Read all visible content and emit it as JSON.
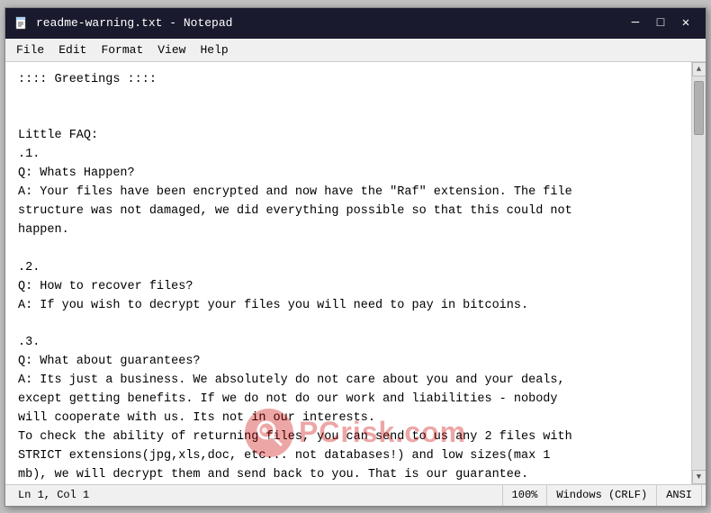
{
  "window": {
    "title": "readme-warning.txt - Notepad",
    "icon": "📄"
  },
  "titlebar": {
    "minimize_label": "─",
    "maximize_label": "□",
    "close_label": "✕"
  },
  "menubar": {
    "items": [
      "File",
      "Edit",
      "Format",
      "View",
      "Help"
    ]
  },
  "content": {
    "text": ":::: Greetings ::::\n\n\nLittle FAQ:\n.1.\nQ: Whats Happen?\nA: Your files have been encrypted and now have the \"Raf\" extension. The file\nstructure was not damaged, we did everything possible so that this could not\nhappen.\n\n.2.\nQ: How to recover files?\nA: If you wish to decrypt your files you will need to pay in bitcoins.\n\n.3.\nQ: What about guarantees?\nA: Its just a business. We absolutely do not care about you and your deals,\nexcept getting benefits. If we do not do our work and liabilities - nobody\nwill cooperate with us. Its not in our interests.\nTo check the ability of returning files, you can send to us any 2 files with\nSTRICT extensions(jpg,xls,doc, etc... not databases!) and low sizes(max 1\nmb), we will decrypt them and send back to you. That is our guarantee."
  },
  "statusbar": {
    "position": "Ln 1, Col 1",
    "zoom": "100%",
    "line_ending": "Windows (CRLF)",
    "encoding": "ANSI"
  },
  "watermark": {
    "text": "PC",
    "suffix": "risk.com"
  }
}
